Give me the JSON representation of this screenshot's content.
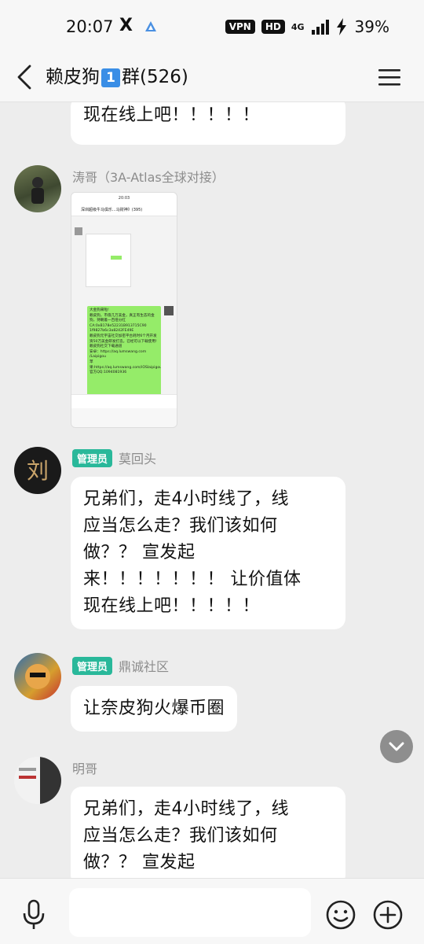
{
  "status_bar": {
    "time": "20:07",
    "x_icon": "X",
    "vpn": "VPN",
    "hd": "HD",
    "network": "4G",
    "battery": "39%"
  },
  "nav": {
    "title_prefix": "赖皮狗",
    "title_num": "1",
    "title_suffix": "群(526)"
  },
  "messages": [
    {
      "bubble": "现在线上吧！！！！！"
    },
    {
      "sender": "涛哥（3A-Atlas全球对接）",
      "screenshot": {
        "time": "20:03",
        "title": "深圳超级牛马俱乐...马财神》(395)",
        "green_text": "大金狗来啦!\n赖皮狗，市值几万美金，真正有生态的金狗，持朝着一百倍分红\nCA:0xB178e52231B913715C90\n1f9827b6c3a8242FE49E\n赖皮狗元宇宙社交加密平台耗时6个月开发资50万美金研发打造。已经可以下载使用!\n赖皮狗社交下载通道\n安卓：https://aq.lumswang.com\n/Laipigou\n苹果:https://aq.lumswang.com/iOSlaipigou\n官方QQ:1094081936"
      }
    },
    {
      "badge": "管理员",
      "sender": "莫回头",
      "bubble": "兄弟们，走4小时线了，线\n应当怎么走？我们该如何\n做？？ 宣发起\n来！！！！！！！ 让价值体\n现在线上吧！！！！！"
    },
    {
      "badge": "管理员",
      "sender": "鼎诚社区",
      "bubble": "让奈皮狗火爆币圈"
    },
    {
      "sender": "明哥",
      "bubble": "兄弟们，走4小时线了，线\n应当怎么走？我们该如何\n做？？ 宣发起"
    }
  ],
  "input": {
    "placeholder": ""
  }
}
